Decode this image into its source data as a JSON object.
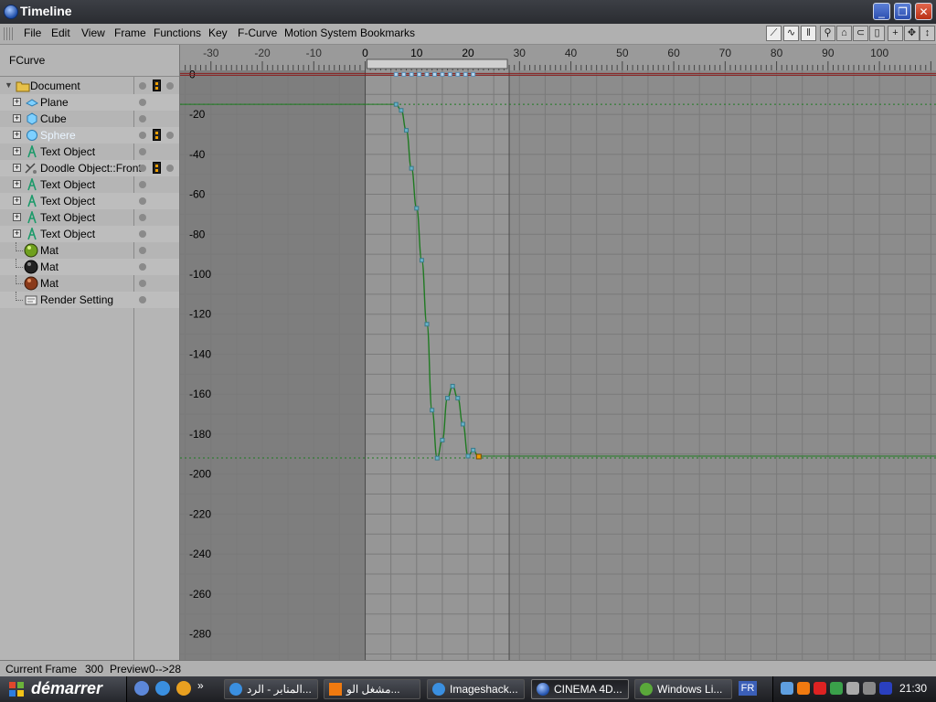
{
  "window": {
    "title": "Timeline"
  },
  "menu": [
    "File",
    "Edit",
    "View",
    "Frame",
    "Functions",
    "Key",
    "F-Curve",
    "Motion System",
    "Bookmarks"
  ],
  "left_panel": {
    "header": "FCurve",
    "tree": [
      {
        "label": "Document",
        "icon": "folder-icon",
        "key": true
      },
      {
        "label": "Plane",
        "icon": "plane-object-icon"
      },
      {
        "label": "Cube",
        "icon": "cube-object-icon"
      },
      {
        "label": "Sphere",
        "icon": "sphere-object-icon",
        "key": true,
        "highlight": true
      },
      {
        "label": "Text Object",
        "icon": "text-object-icon"
      },
      {
        "label": "Doodle Object::Front",
        "icon": "doodle-object-icon",
        "key": true
      },
      {
        "label": "Text Object",
        "icon": "text-object-icon"
      },
      {
        "label": "Text Object",
        "icon": "text-object-icon"
      },
      {
        "label": "Text Object",
        "icon": "text-object-icon"
      },
      {
        "label": "Text Object",
        "icon": "text-object-icon"
      },
      {
        "label": "Mat",
        "icon": "material-green-icon"
      },
      {
        "label": "Mat",
        "icon": "material-black-icon"
      },
      {
        "label": "Mat",
        "icon": "material-brown-icon"
      },
      {
        "label": "Render Setting",
        "icon": "render-setting-icon"
      }
    ]
  },
  "graph": {
    "x_ticks": [
      "-30",
      "-20",
      "-10",
      "0",
      "10",
      "20",
      "30",
      "40",
      "50",
      "60",
      "70",
      "80",
      "90",
      "100"
    ],
    "y_ticks": [
      "0",
      "-20",
      "-40",
      "-60",
      "-80",
      "-100",
      "-120",
      "-140",
      "-160",
      "-180",
      "-200",
      "-220",
      "-240",
      "-260",
      "-280"
    ],
    "curve": {
      "x": [
        6,
        7,
        8,
        9,
        10,
        11,
        12,
        13,
        14,
        15,
        16,
        17,
        18,
        19,
        20,
        21,
        22
      ],
      "y": [
        -15,
        -18,
        -28,
        -47,
        -67,
        -93,
        -125,
        -168,
        -192,
        -183,
        -162,
        -156,
        -162,
        -175,
        -191,
        -188,
        -191
      ]
    },
    "x_range": [
      -36,
      111
    ],
    "y_range": [
      2,
      -293
    ],
    "grid": true,
    "colors": {
      "curve": "#1f7a22",
      "key": "#67b3c9",
      "zero_line": "#8a1f1f",
      "end_key": "#f0a000"
    }
  },
  "status": {
    "current_frame_label": "Current Frame",
    "current_frame": "300",
    "preview_label": "Preview",
    "preview": "0-->28"
  },
  "taskbar": {
    "start": "démarrer",
    "tasks": [
      "المنابر - الرد...",
      "مشغل الو...",
      "Imageshack...",
      "CINEMA 4D...",
      "Windows Li..."
    ],
    "lang": "FR",
    "clock": "21:30"
  }
}
